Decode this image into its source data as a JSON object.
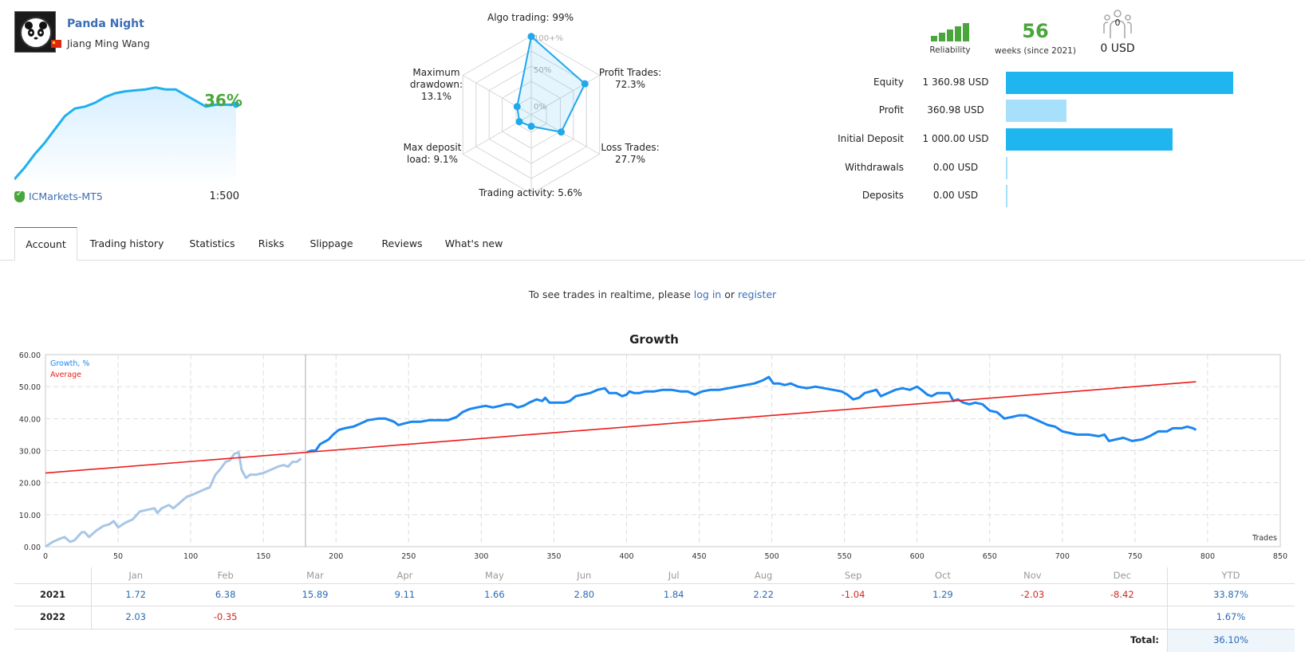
{
  "header": {
    "signal_name": "Panda Night",
    "author": "Jiang Ming Wang",
    "country_flag": "china-flag",
    "growth_pct_label": "36%",
    "broker": "ICMarkets-MT5",
    "leverage": "1:500",
    "sparkline": [
      0,
      6,
      13,
      19,
      26,
      33,
      37,
      38,
      40,
      43,
      45,
      46,
      46.5,
      47,
      48,
      47,
      47,
      44,
      41,
      38,
      39,
      39,
      39
    ]
  },
  "radar": {
    "labels": {
      "algo": "Algo trading: 99%",
      "profit_trades_1": "Profit Trades:",
      "profit_trades_2": "72.3%",
      "loss_trades_1": "Loss Trades:",
      "loss_trades_2": "27.7%",
      "activity": "Trading activity: 5.6%",
      "deposit_load_1": "Max deposit",
      "deposit_load_2": "load: 9.1%",
      "drawdown_1": "Maximum",
      "drawdown_2": "drawdown:",
      "drawdown_3": "13.1%"
    },
    "ring_labels": [
      "0%",
      "50%",
      "100+%"
    ],
    "values": [
      {
        "axis": "Algo trading",
        "value": 99
      },
      {
        "axis": "Profit Trades",
        "value": 72.3
      },
      {
        "axis": "Loss Trades",
        "value": 27.7
      },
      {
        "axis": "Trading activity",
        "value": 5.6
      },
      {
        "axis": "Max deposit load",
        "value": 9.1
      },
      {
        "axis": "Maximum drawdown",
        "value": 13.1
      }
    ]
  },
  "stats": {
    "reliability_label": "Reliability",
    "reliability_level": 5,
    "weeks": "56",
    "weeks_label": "weeks (since 2021)",
    "subscribers": "0",
    "subscribers_funds": "0 USD",
    "rows": [
      {
        "label": "Equity",
        "value": "1 360.98 USD",
        "amount": 1360.98,
        "color": "#1fb6ef"
      },
      {
        "label": "Profit",
        "value": "360.98 USD",
        "amount": 360.98,
        "color": "#a8e0fb"
      },
      {
        "label": "Initial Deposit",
        "value": "1 000.00 USD",
        "amount": 1000.0,
        "color": "#1fb6ef"
      },
      {
        "label": "Withdrawals",
        "value": "0.00 USD",
        "amount": 0,
        "color": "#a8e0fb"
      },
      {
        "label": "Deposits",
        "value": "0.00 USD",
        "amount": 0,
        "color": "#a8e0fb"
      }
    ]
  },
  "tabs": [
    {
      "label": "Account",
      "active": true
    },
    {
      "label": "Trading history",
      "active": false
    },
    {
      "label": "Statistics",
      "active": false
    },
    {
      "label": "Risks",
      "active": false
    },
    {
      "label": "Slippage",
      "active": false
    },
    {
      "label": "Reviews",
      "active": false
    },
    {
      "label": "What's new",
      "active": false
    }
  ],
  "notice": {
    "prefix": "To see trades in realtime, please ",
    "login": "log in",
    "or": " or ",
    "register": "register"
  },
  "chart_data": {
    "type": "line",
    "title": "Growth",
    "xlabel": "Trades",
    "ylabel": "",
    "xlim": [
      0,
      850
    ],
    "ylim": [
      0,
      60
    ],
    "x_ticks": [
      0,
      50,
      100,
      150,
      200,
      250,
      300,
      350,
      400,
      450,
      500,
      550,
      600,
      650,
      700,
      750,
      800,
      850
    ],
    "y_ticks": [
      "0.00",
      "10.00",
      "20.00",
      "30.00",
      "40.00",
      "50.00",
      "60.00"
    ],
    "grid": true,
    "legend": [
      "Growth, %",
      "Average"
    ],
    "legend_position": "top-left",
    "history_split_x": 179,
    "series": [
      {
        "name": "Growth, %",
        "color": "#1a86f0",
        "history_color": "#a9c6e6",
        "points": [
          [
            0,
            0
          ],
          [
            5,
            1.5
          ],
          [
            10,
            2.5
          ],
          [
            13,
            3
          ],
          [
            17,
            1.5
          ],
          [
            20,
            2
          ],
          [
            25,
            4.5
          ],
          [
            27,
            4.5
          ],
          [
            30,
            3
          ],
          [
            35,
            5
          ],
          [
            40,
            6.5
          ],
          [
            44,
            7
          ],
          [
            47,
            8
          ],
          [
            50,
            6
          ],
          [
            55,
            7.5
          ],
          [
            60,
            8.5
          ],
          [
            65,
            11
          ],
          [
            70,
            11.5
          ],
          [
            75,
            12
          ],
          [
            77,
            10.5
          ],
          [
            80,
            12
          ],
          [
            85,
            13
          ],
          [
            88,
            12
          ],
          [
            92,
            13.5
          ],
          [
            97,
            15.5
          ],
          [
            100,
            16
          ],
          [
            105,
            17
          ],
          [
            110,
            18
          ],
          [
            113,
            18.5
          ],
          [
            117,
            22.5
          ],
          [
            120,
            24
          ],
          [
            124,
            26.5
          ],
          [
            127,
            27
          ],
          [
            130,
            29
          ],
          [
            133,
            29.5
          ],
          [
            135,
            24
          ],
          [
            138,
            21.5
          ],
          [
            141,
            22.5
          ],
          [
            145,
            22.5
          ],
          [
            150,
            23
          ],
          [
            155,
            24
          ],
          [
            160,
            25
          ],
          [
            164,
            25.5
          ],
          [
            167,
            25
          ],
          [
            170,
            26.5
          ],
          [
            173,
            26.5
          ],
          [
            176,
            27.5
          ],
          [
            180,
            29.5
          ],
          [
            183,
            30
          ],
          [
            186,
            30
          ],
          [
            189,
            32
          ],
          [
            193,
            33
          ],
          [
            195,
            33.5
          ],
          [
            198,
            35
          ],
          [
            202,
            36.5
          ],
          [
            206,
            37
          ],
          [
            212,
            37.5
          ],
          [
            217,
            38.5
          ],
          [
            222,
            39.5
          ],
          [
            229,
            40
          ],
          [
            234,
            40
          ],
          [
            240,
            39
          ],
          [
            243,
            38
          ],
          [
            247,
            38.5
          ],
          [
            252,
            39
          ],
          [
            258,
            39
          ],
          [
            264,
            39.5
          ],
          [
            271,
            39.5
          ],
          [
            277,
            39.5
          ],
          [
            283,
            40.5
          ],
          [
            287,
            42
          ],
          [
            292,
            43
          ],
          [
            297,
            43.5
          ],
          [
            303,
            44
          ],
          [
            308,
            43.5
          ],
          [
            313,
            44
          ],
          [
            317,
            44.5
          ],
          [
            321,
            44.5
          ],
          [
            325,
            43.5
          ],
          [
            329,
            44
          ],
          [
            333,
            45
          ],
          [
            338,
            46
          ],
          [
            342,
            45.5
          ],
          [
            344,
            46.5
          ],
          [
            347,
            45
          ],
          [
            352,
            45
          ],
          [
            357,
            45
          ],
          [
            361,
            45.5
          ],
          [
            365,
            47
          ],
          [
            370,
            47.5
          ],
          [
            375,
            48
          ],
          [
            380,
            49
          ],
          [
            385,
            49.5
          ],
          [
            388,
            48
          ],
          [
            393,
            48
          ],
          [
            397,
            47
          ],
          [
            400,
            47.5
          ],
          [
            402,
            48.5
          ],
          [
            405,
            48
          ],
          [
            409,
            48
          ],
          [
            413,
            48.5
          ],
          [
            419,
            48.5
          ],
          [
            425,
            49
          ],
          [
            431,
            49
          ],
          [
            437,
            48.5
          ],
          [
            442,
            48.5
          ],
          [
            447,
            47.5
          ],
          [
            452,
            48.5
          ],
          [
            458,
            49
          ],
          [
            464,
            49
          ],
          [
            470,
            49.5
          ],
          [
            476,
            50
          ],
          [
            482,
            50.5
          ],
          [
            488,
            51
          ],
          [
            494,
            52
          ],
          [
            498,
            53
          ],
          [
            501,
            51
          ],
          [
            505,
            51
          ],
          [
            509,
            50.5
          ],
          [
            513,
            51
          ],
          [
            518,
            50
          ],
          [
            524,
            49.5
          ],
          [
            530,
            50
          ],
          [
            536,
            49.5
          ],
          [
            542,
            49
          ],
          [
            548,
            48.5
          ],
          [
            552,
            47.5
          ],
          [
            556,
            46
          ],
          [
            560,
            46.5
          ],
          [
            564,
            48
          ],
          [
            568,
            48.5
          ],
          [
            572,
            49
          ],
          [
            575,
            47
          ],
          [
            580,
            48
          ],
          [
            585,
            49
          ],
          [
            590,
            49.5
          ],
          [
            595,
            49
          ],
          [
            600,
            50
          ],
          [
            603,
            49
          ],
          [
            607,
            47.5
          ],
          [
            610,
            47
          ],
          [
            614,
            48
          ],
          [
            618,
            48
          ],
          [
            622,
            48
          ],
          [
            625,
            45.5
          ],
          [
            628,
            46
          ],
          [
            632,
            45
          ],
          [
            636,
            44.5
          ],
          [
            640,
            45
          ],
          [
            645,
            44.5
          ],
          [
            650,
            42.5
          ],
          [
            655,
            42
          ],
          [
            660,
            40
          ],
          [
            665,
            40.5
          ],
          [
            670,
            41
          ],
          [
            675,
            41
          ],
          [
            680,
            40
          ],
          [
            685,
            39
          ],
          [
            690,
            38
          ],
          [
            695,
            37.5
          ],
          [
            700,
            36
          ],
          [
            705,
            35.5
          ],
          [
            710,
            35
          ],
          [
            718,
            35
          ],
          [
            725,
            34.5
          ],
          [
            729,
            35
          ],
          [
            732,
            33
          ],
          [
            737,
            33.5
          ],
          [
            742,
            34
          ],
          [
            748,
            33
          ],
          [
            755,
            33.5
          ],
          [
            760,
            34.5
          ],
          [
            766,
            36
          ],
          [
            772,
            36
          ],
          [
            776,
            37
          ],
          [
            782,
            37
          ],
          [
            786,
            37.5
          ],
          [
            790,
            37
          ],
          [
            792,
            36.5
          ]
        ]
      },
      {
        "name": "Average",
        "color": "#ec1c1c",
        "points": [
          [
            0,
            23
          ],
          [
            792,
            51.5
          ]
        ]
      }
    ]
  },
  "monthly_table": {
    "headers": [
      "",
      "Jan",
      "Feb",
      "Mar",
      "Apr",
      "May",
      "Jun",
      "Jul",
      "Aug",
      "Sep",
      "Oct",
      "Nov",
      "Dec",
      "YTD"
    ],
    "rows": [
      {
        "year": "2021",
        "values": [
          "1.72",
          "6.38",
          "15.89",
          "9.11",
          "1.66",
          "2.80",
          "1.84",
          "2.22",
          "-1.04",
          "1.29",
          "-2.03",
          "-8.42"
        ],
        "ytd": "33.87%"
      },
      {
        "year": "2022",
        "values": [
          "2.03",
          "-0.35",
          "",
          "",
          "",
          "",
          "",
          "",
          "",
          "",
          "",
          ""
        ],
        "ytd": "1.67%"
      }
    ],
    "total_label": "Total:",
    "total_value": "36.10%"
  }
}
